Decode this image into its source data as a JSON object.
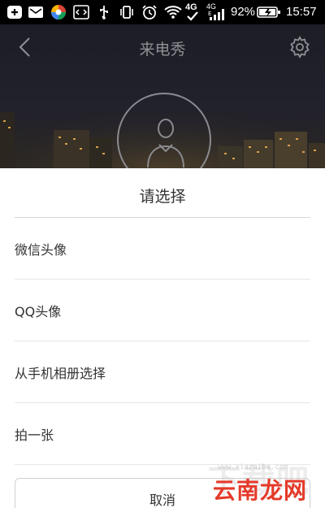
{
  "status_bar": {
    "network": "4G",
    "network_secondary": "4G",
    "battery_percent": "92%",
    "time": "15:57"
  },
  "header": {
    "title": "来电秀"
  },
  "sheet": {
    "title": "请选择",
    "options": [
      {
        "label": "微信头像"
      },
      {
        "label": "QQ头像"
      },
      {
        "label": "从手机相册选择"
      },
      {
        "label": "拍一张"
      }
    ],
    "cancel_label": "取消"
  },
  "watermark": {
    "background_text": "下载吧",
    "text": "云南龙网",
    "url": "www.xiazaiba.com"
  },
  "colors": {
    "sheet_bg": "#ffffff",
    "header_title": "#8f8f95",
    "watermark": "#e53a2a"
  }
}
